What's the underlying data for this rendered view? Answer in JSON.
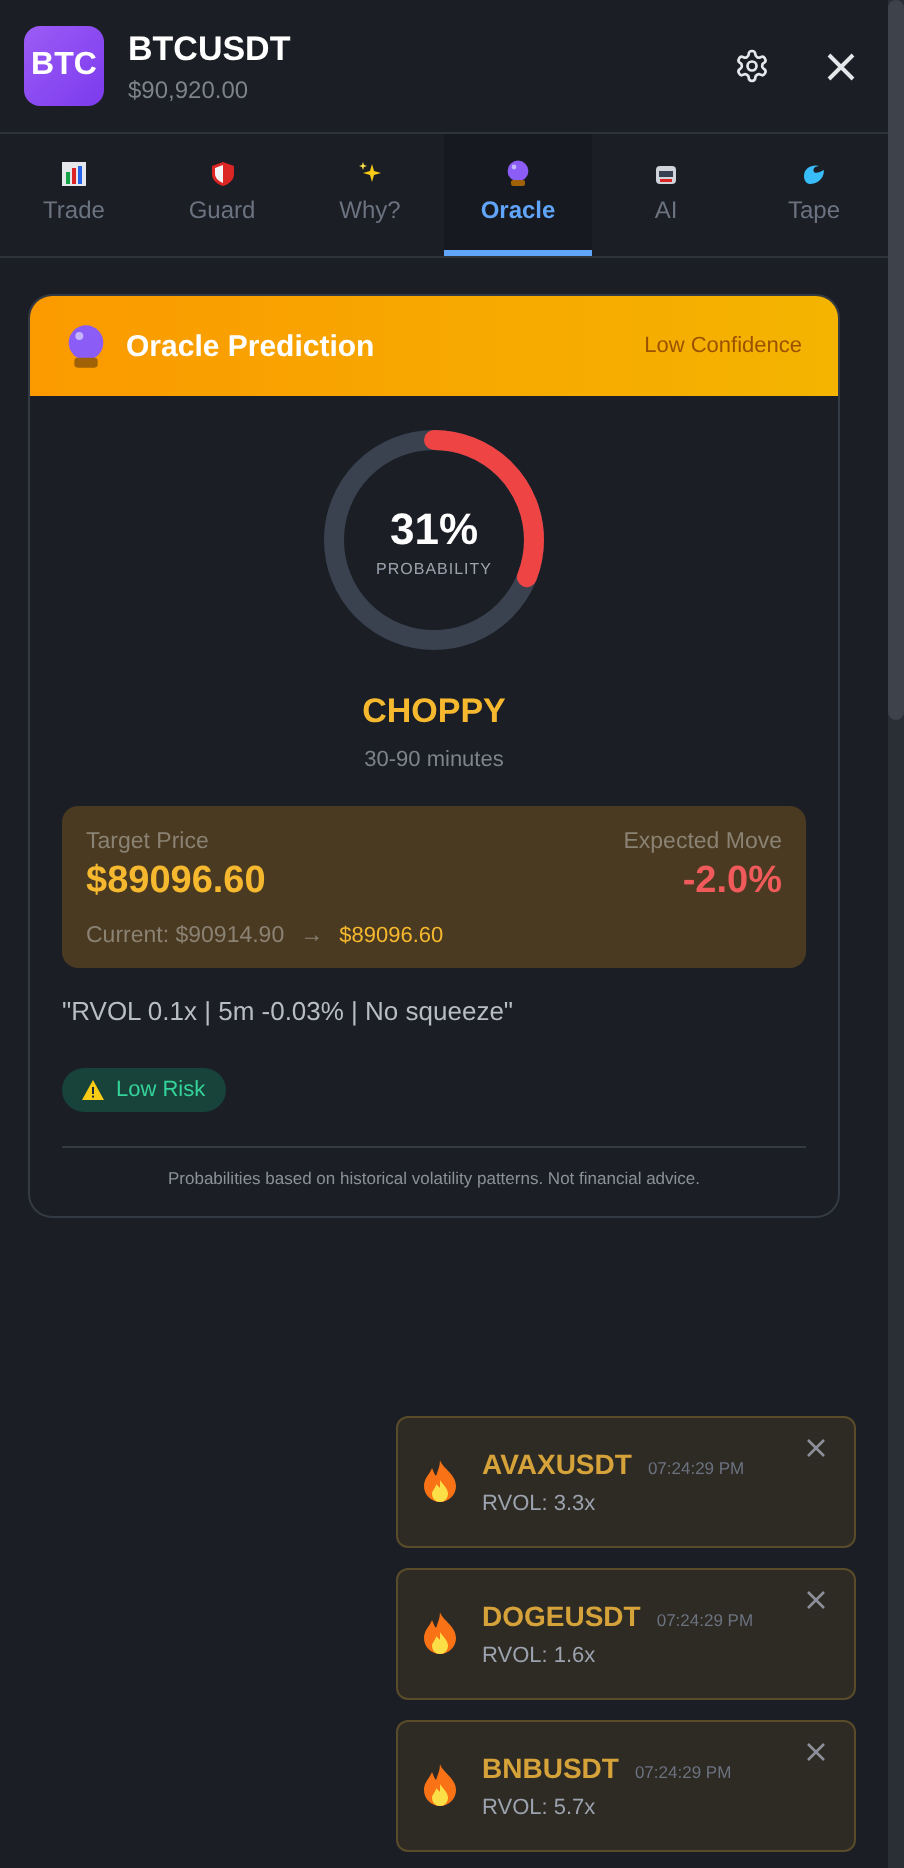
{
  "header": {
    "logo": "BTC",
    "symbol": "BTCUSDT",
    "price": "$90,920.00"
  },
  "tabs": [
    {
      "label": "Trade",
      "selected": false
    },
    {
      "label": "Guard",
      "selected": false
    },
    {
      "label": "Why?",
      "selected": false
    },
    {
      "label": "Oracle",
      "selected": true
    },
    {
      "label": "AI",
      "selected": false
    },
    {
      "label": "Tape",
      "selected": false
    }
  ],
  "prediction": {
    "title": "Oracle Prediction",
    "confidence": "Low Confidence",
    "level": 0.31,
    "percent": "31%",
    "percent_label": "PROBABILITY",
    "regime": "CHOPPY",
    "horizon": "30-90 minutes",
    "target": {
      "label": "Target Price",
      "price": "$89096.60",
      "move_label": "Expected Move",
      "move": "-2.0%",
      "current": "Current: $90914.90",
      "arrow": "→",
      "to": "$89096.60"
    },
    "reason": "\"RVOL 0.1x | 5m -0.03% | No squeeze\"",
    "risk": "Low Risk",
    "disclaimer": "Probabilities based on historical volatility patterns. Not financial advice."
  },
  "toasts": [
    {
      "symbol": "AVAXUSDT",
      "time": "07:24:29 PM",
      "detail": "RVOL: 3.3x"
    },
    {
      "symbol": "DOGEUSDT",
      "time": "07:24:29 PM",
      "detail": "RVOL: 1.6x"
    },
    {
      "symbol": "BNBUSDT",
      "time": "07:24:29 PM",
      "detail": "RVOL: 5.7x"
    }
  ]
}
